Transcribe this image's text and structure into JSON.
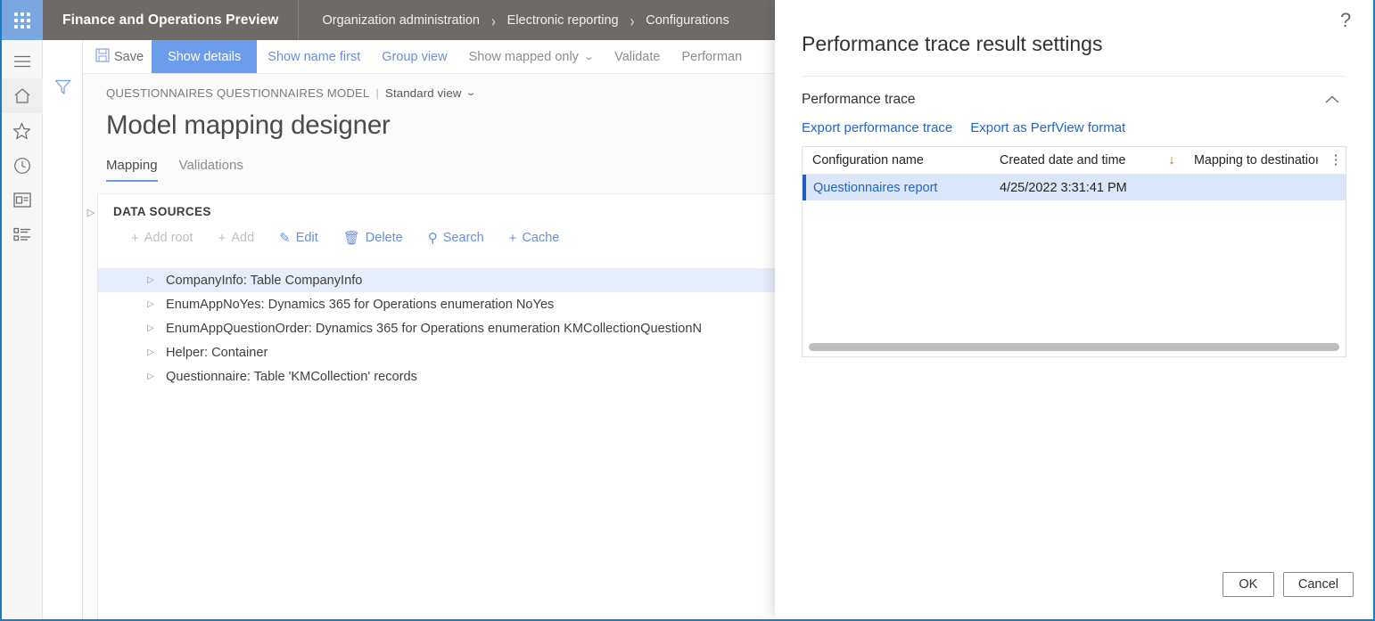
{
  "topbar": {
    "waffle_icon": "waffle-grid-icon",
    "app_title": "Finance and Operations Preview",
    "breadcrumb": [
      "Organization administration",
      "Electronic reporting",
      "Configurations"
    ],
    "separator": "›",
    "help_label": "?"
  },
  "leftrail": {
    "items": [
      {
        "name": "hamburger-menu-icon",
        "label": "Menu"
      },
      {
        "name": "home-icon",
        "label": "Home"
      },
      {
        "name": "star-icon",
        "label": "Favorites"
      },
      {
        "name": "clock-icon",
        "label": "Recent"
      },
      {
        "name": "workspace-icon",
        "label": "Workspaces"
      },
      {
        "name": "modules-list-icon",
        "label": "Modules"
      }
    ]
  },
  "filtercol": {
    "filter_icon": "filter-funnel-icon"
  },
  "commandbar": {
    "save": "Save",
    "show_details": "Show details",
    "show_name_first": "Show name first",
    "group_view": "Group view",
    "show_mapped_only": "Show mapped only",
    "show_mapped_only_chevron": "⌄",
    "validate": "Validate",
    "performance": "Performan"
  },
  "page": {
    "mini_breadcrumb": "QUESTIONNAIRES QUESTIONNAIRES MODEL",
    "pipe": "|",
    "view_selector": "Standard view",
    "view_chevron": "⌄",
    "title": "Model mapping designer",
    "tabs": [
      {
        "label": "Mapping",
        "selected": true
      },
      {
        "label": "Validations",
        "selected": false
      }
    ]
  },
  "datasources": {
    "expander": "▷",
    "section_title": "DATA SOURCES",
    "toolbar": [
      {
        "label": "Add root",
        "icon": "plus-icon",
        "glyph": "+",
        "disabled": true
      },
      {
        "label": "Add",
        "icon": "plus-icon",
        "glyph": "+",
        "disabled": true
      },
      {
        "label": "Edit",
        "icon": "pencil-icon",
        "glyph": "✎",
        "disabled": false
      },
      {
        "label": "Delete",
        "icon": "trash-icon",
        "glyph": "🗑",
        "disabled": false
      },
      {
        "label": "Search",
        "icon": "search-icon",
        "glyph": "⚲",
        "disabled": false
      },
      {
        "label": "Cache",
        "icon": "plus-icon",
        "glyph": "+",
        "disabled": false
      }
    ],
    "rows": [
      {
        "caret": "▷",
        "label": "CompanyInfo: Table CompanyInfo",
        "selected": true
      },
      {
        "caret": "▷",
        "label": "EnumAppNoYes: Dynamics 365 for Operations enumeration NoYes",
        "selected": false
      },
      {
        "caret": "▷",
        "label": "EnumAppQuestionOrder: Dynamics 365 for Operations enumeration KMCollectionQuestionN",
        "selected": false
      },
      {
        "caret": "▷",
        "label": "Helper: Container",
        "selected": false
      },
      {
        "caret": "▷",
        "label": "Questionnaire: Table 'KMCollection' records",
        "selected": false
      }
    ]
  },
  "dialog": {
    "title": "Performance trace result settings",
    "section_label": "Performance trace",
    "collapse_icon": "chevron-up-icon",
    "collapse_glyph": "⌃",
    "links": [
      "Export performance trace",
      "Export as PerfView format"
    ],
    "grid": {
      "columns": [
        "Configuration name",
        "Created date and time",
        "Mapping to destinatioı"
      ],
      "sort_icon": "sort-descending-arrow-icon",
      "sort_glyph": "↓",
      "kebab_icon": "column-options-kebab-icon",
      "kebab_glyph": "⋮",
      "rows": [
        {
          "configuration_name": "Questionnaires report",
          "created_date_and_time": "4/25/2022 3:31:41 PM",
          "mapping_to_destination": "",
          "selected": true
        }
      ],
      "hscrollbar": "horizontal-scrollbar"
    },
    "buttons": {
      "ok": "OK",
      "cancel": "Cancel"
    }
  },
  "colors": {
    "topbar_bg": "#6d6a67",
    "waffle_bg": "#7aa7e0",
    "accent_blue": "#6c9ceb",
    "link_blue": "#6c8fd6",
    "dialog_link": "#2266c8",
    "row_selected": "#dbe6f8",
    "page_border": "#1a7dc4"
  }
}
